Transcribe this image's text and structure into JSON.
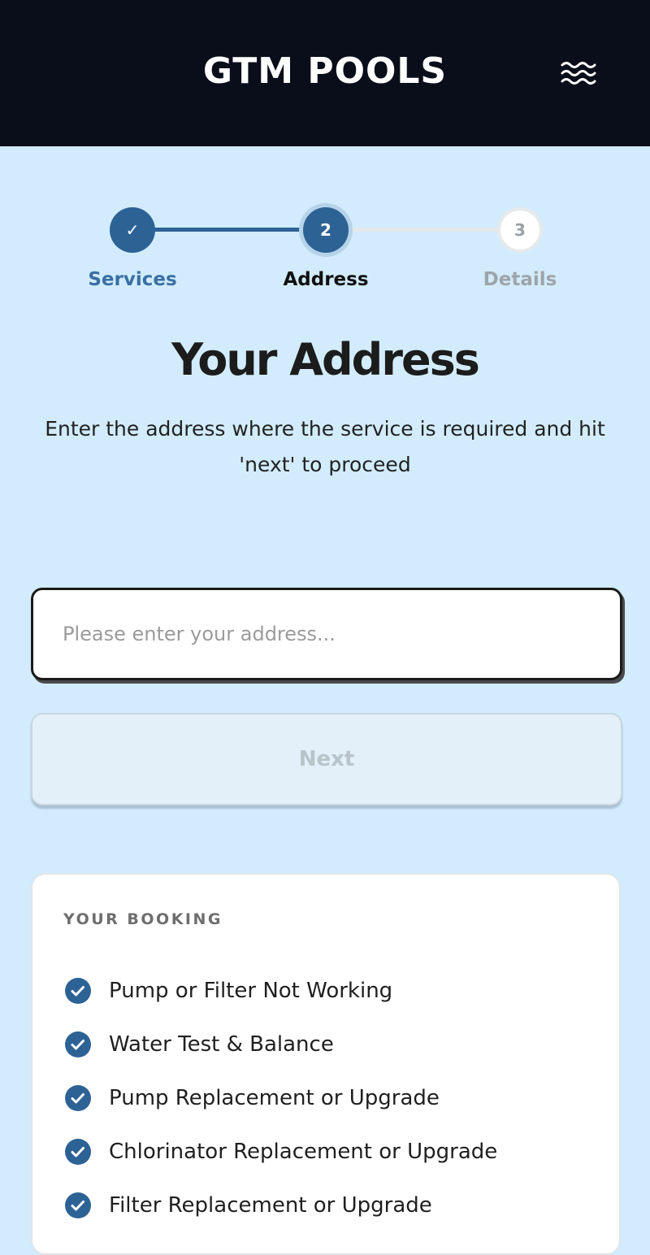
{
  "header": {
    "brand": "GTM POOLS",
    "menu_icon": "waves-menu-icon"
  },
  "stepper": {
    "current_step": 2,
    "steps": [
      {
        "label": "Services",
        "marker": "✓",
        "state": "completed"
      },
      {
        "label": "Address",
        "marker": "2",
        "state": "active"
      },
      {
        "label": "Details",
        "marker": "3",
        "state": "upcoming"
      }
    ]
  },
  "main": {
    "title": "Your Address",
    "subtitle": "Enter the address where the service is required and hit 'next' to proceed",
    "address_input": {
      "value": "",
      "placeholder": "Please enter your address..."
    },
    "next_label": "Next"
  },
  "booking": {
    "title": "YOUR BOOKING",
    "items": [
      "Pump or Filter Not Working",
      "Water Test & Balance",
      "Pump Replacement or Upgrade",
      "Chlorinator Replacement or Upgrade",
      "Filter Replacement or Upgrade"
    ]
  },
  "colors": {
    "header_bg": "#0a0e1a",
    "page_bg": "#d2ecfd",
    "accent": "#2d6295",
    "inactive": "#9ea4aa"
  }
}
